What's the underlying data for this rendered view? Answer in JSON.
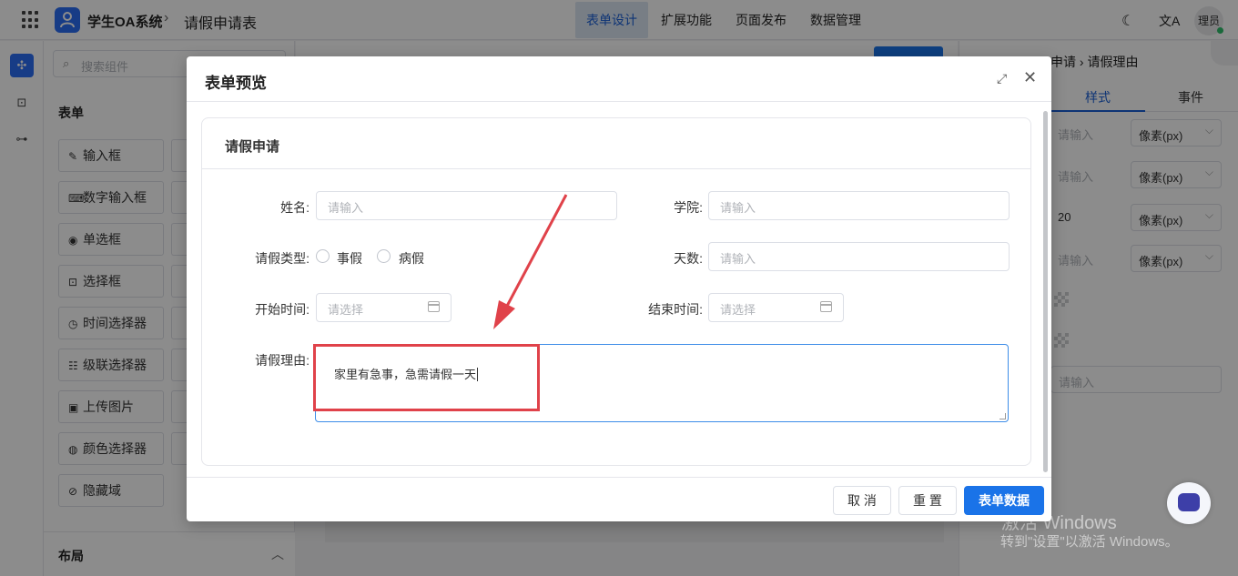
{
  "topbar": {
    "app_title": "学生OA系统",
    "breadcrumb_sep": "›",
    "page_name": "请假申请表",
    "tabs": [
      {
        "label": "表单设计",
        "active": true
      },
      {
        "label": "扩展功能",
        "active": false
      },
      {
        "label": "页面发布",
        "active": false
      },
      {
        "label": "数据管理",
        "active": false
      }
    ],
    "theme_icon": "moon-icon",
    "lang_icon": "translate-icon",
    "avatar_label": "理员"
  },
  "components": {
    "search_placeholder": "搜索组件",
    "form_section": "表单",
    "items": [
      "输入框",
      "数字输入框",
      "单选框",
      "选择框",
      "时间选择器",
      "级联选择器",
      "上传图片",
      "颜色选择器",
      "隐藏域"
    ],
    "layout_section": "布局"
  },
  "right_panel": {
    "path_a": "申请",
    "path_b": "请假理由",
    "tabs": [
      "样式",
      "事件"
    ],
    "rows": [
      {
        "value": "请输入",
        "unit": "像素(px)"
      },
      {
        "value": "请输入",
        "unit": "像素(px)"
      },
      {
        "value": "20",
        "unit": "像素(px)"
      },
      {
        "value": "请输入",
        "unit": "像素(px)"
      }
    ],
    "last_input": "请输入"
  },
  "dialog": {
    "title": "表单预览",
    "card_title": "请假申请",
    "fields": {
      "name": {
        "label": "姓名:",
        "placeholder": "请输入"
      },
      "college": {
        "label": "学院:",
        "placeholder": "请输入"
      },
      "leave_type": {
        "label": "请假类型:",
        "options": [
          "事假",
          "病假"
        ]
      },
      "days": {
        "label": "天数:",
        "placeholder": "请输入"
      },
      "start_time": {
        "label": "开始时间:",
        "placeholder": "请选择"
      },
      "end_time": {
        "label": "结束时间:",
        "placeholder": "请选择"
      },
      "reason": {
        "label": "请假理由:",
        "value": "家里有急事，急需请假一天"
      }
    },
    "buttons": {
      "cancel": "取 消",
      "reset": "重 置",
      "submit": "表单数据"
    }
  },
  "watermark": {
    "line1": "激活 Windows",
    "line2": "转到\"设置\"以激活 Windows。"
  },
  "colors": {
    "primary": "#1a73e8",
    "highlight": "#e0424a"
  }
}
